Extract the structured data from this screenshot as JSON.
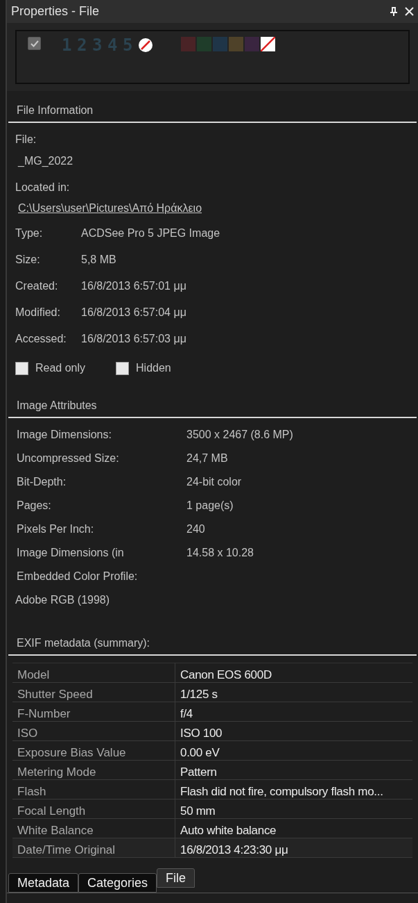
{
  "window": {
    "title": "Properties - File"
  },
  "label_bar": {
    "tagged": true,
    "ratings": [
      "1",
      "2",
      "3",
      "4",
      "5"
    ],
    "color_labels": [
      {
        "color": "#4a2326"
      },
      {
        "color": "#1f3d2a"
      },
      {
        "color": "#1f3548"
      },
      {
        "color": "#4f4229"
      },
      {
        "color": "#3a2540"
      }
    ]
  },
  "file_information": {
    "title": "File Information",
    "file_label": "File:",
    "file_name": "_MG_2022",
    "located_label": "Located in:",
    "location": "C:\\Users\\user\\Pictures\\Από Ηράκλειο",
    "fields": [
      {
        "label": "Type:",
        "value": "ACDSee Pro 5 JPEG Image"
      },
      {
        "label": "Size:",
        "value": "5,8 MB"
      },
      {
        "label": "Created:",
        "value": "16/8/2013 6:57:01 μμ"
      },
      {
        "label": "Modified:",
        "value": "16/8/2013 6:57:04 μμ"
      },
      {
        "label": "Accessed:",
        "value": "16/8/2013 6:57:03 μμ"
      }
    ],
    "checkboxes": [
      {
        "label": "Read only",
        "checked": false
      },
      {
        "label": "Hidden",
        "checked": false
      }
    ]
  },
  "image_attributes": {
    "title": "Image Attributes",
    "rows": [
      {
        "label": "Image Dimensions:",
        "value": "3500 x 2467 (8.6 MP)"
      },
      {
        "label": "Uncompressed Size:",
        "value": "24,7 MB"
      },
      {
        "label": "Bit-Depth:",
        "value": "24-bit color"
      },
      {
        "label": "Pages:",
        "value": "1 page(s)"
      },
      {
        "label": "Pixels Per Inch:",
        "value": "240"
      },
      {
        "label": "Image Dimensions (in",
        "value": "14.58 x 10.28"
      },
      {
        "label": "Embedded Color Profile:"
      }
    ],
    "profile": "Adobe RGB (1998)"
  },
  "exif": {
    "title": "EXIF metadata (summary):",
    "rows": [
      {
        "name": "Model",
        "value": "Canon EOS 600D"
      },
      {
        "name": "Shutter Speed",
        "value": "1/125 s"
      },
      {
        "name": "F-Number",
        "value": "f/4"
      },
      {
        "name": "ISO",
        "value": "ISO 100"
      },
      {
        "name": "Exposure Bias Value",
        "value": "0.00 eV"
      },
      {
        "name": "Metering Mode",
        "value": "Pattern"
      },
      {
        "name": "Flash",
        "value": "Flash did not fire, compulsory flash mo..."
      },
      {
        "name": "Focal Length",
        "value": "50 mm"
      },
      {
        "name": "White Balance",
        "value": "Auto white balance"
      },
      {
        "name": "Date/Time Original",
        "value": "16/8/2013 4:23:30 μμ"
      }
    ]
  },
  "tabs": [
    {
      "label": "Metadata",
      "selected": false
    },
    {
      "label": "Categories",
      "selected": false
    },
    {
      "label": "File",
      "selected": true
    }
  ]
}
